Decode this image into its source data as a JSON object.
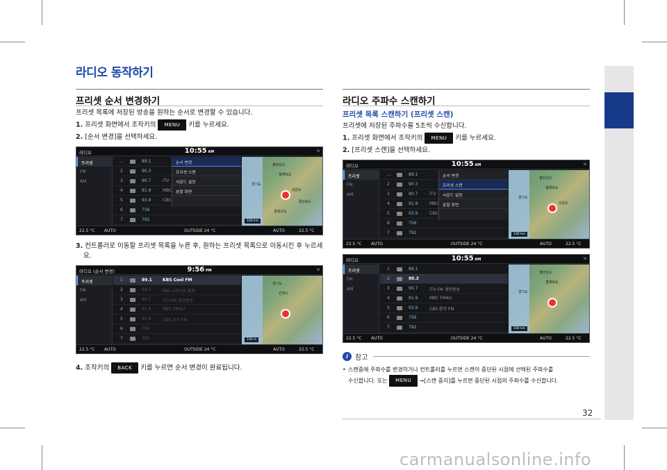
{
  "main_title": "라디오 동작하기",
  "left": {
    "title": "프리셋 순서 변경하기",
    "intro": "프리셋 목록에 저장된 방송을 원하는 순서로 변경할 수 있습니다.",
    "step1_num": "1.",
    "step1_pre": "프리셋 화면에서 조작키의",
    "step1_btn": "MENU",
    "step1_post": "키를 누르세요.",
    "step2_num": "2.",
    "step2_text": "[순서 변경]을 선택하세요.",
    "step3_num": "3.",
    "step3_text": "컨트롤러로 이동할 프리셋 목록을 누른 후, 원하는 프리셋 목록으로 이동시킨 후 누르세요.",
    "step4_num": "4.",
    "step4_pre": "조작키의",
    "step4_btn": "BACK",
    "step4_post": "키를 누르면 순서 변경이 완료됩니다."
  },
  "right": {
    "title": "라디오 주파수 스캔하기",
    "subtitle": "프리셋 목록 스캔하기 (프리셋 스캔)",
    "intro": "프리셋에 저장된 주파수를 5초씩 수신합니다.",
    "step1_num": "1.",
    "step1_pre": "프리셋 화면에서 조작키의",
    "step1_btn": "MENU",
    "step1_post": "키를 누르세요.",
    "step2_num": "2.",
    "step2_text": "[프리셋 스캔]을 선택하세요.",
    "note_label": "참고",
    "note_1": "스캔중에 주파수를 변경하거나 컨트롤러를 누르면 스캔이 중단된 시점에 선택된 주파수를",
    "note_2_pre": "수신합니다. 또는",
    "note_btn": "MENU",
    "note_2_post": "→[스캔 중지]를 누르면 중단된 시점의 주파수를 수신합니다."
  },
  "screens": {
    "s1": {
      "title": "라디오",
      "clock": "10:55",
      "ampm": "AM",
      "bands": [
        "프리셋",
        "FM",
        "AM"
      ],
      "rows": [
        {
          "n": "...",
          "f": "89.1",
          "s": ""
        },
        {
          "n": "2",
          "f": "90.3",
          "s": ""
        },
        {
          "n": "3",
          "f": "90.7",
          "s": "iTV"
        },
        {
          "n": "4",
          "f": "91.9",
          "s": "MBC"
        },
        {
          "n": "5",
          "f": "93.9",
          "s": "CBS"
        },
        {
          "n": "6",
          "f": "756",
          "s": ""
        },
        {
          "n": "7",
          "f": "792",
          "s": ""
        }
      ],
      "menu": [
        "순서 변경",
        "프리셋 스캔",
        "사운드 설정",
        "분할 화면"
      ],
      "bottom": [
        "22.5 °C",
        "AUTO",
        "OUTSIDE  24 °C",
        "AUTO",
        "22.5 °C"
      ],
      "map": [
        "평안남도",
        "황해북도",
        "경기도",
        "강원도",
        "경상북도",
        "충청남도"
      ],
      "dist": "100 km"
    },
    "s2": {
      "title": "라디오 (순서 변경)",
      "clock": "9:56",
      "ampm": "PM",
      "bands": [
        "프리셋",
        "FM",
        "AM"
      ],
      "rows": [
        {
          "n": "1",
          "f": "89.1",
          "s": "KBS Cool FM"
        },
        {
          "n": "2",
          "f": "90.3",
          "s": "KBS 1라디오 표준"
        },
        {
          "n": "3",
          "f": "90.7",
          "s": "iTV FM 경인방송"
        },
        {
          "n": "4",
          "f": "91.9",
          "s": "MBC FM4U"
        },
        {
          "n": "5",
          "f": "93.9",
          "s": "CBS 음악 FM"
        },
        {
          "n": "6",
          "f": "756",
          "s": ""
        },
        {
          "n": "7",
          "f": "792",
          "s": ""
        }
      ],
      "bottom": [
        "22.5 °C",
        "AUTO",
        "OUTSIDE  24 °C",
        "AUTO",
        "22.5 °C"
      ],
      "map": [
        "경기도",
        "킨텍스"
      ],
      "dist": "100 m"
    },
    "s3": {
      "title": "라디오",
      "clock": "10:55",
      "ampm": "AM",
      "bands": [
        "프리셋",
        "FM",
        "AM"
      ],
      "rows": [
        {
          "n": "...",
          "f": "89.1",
          "s": ""
        },
        {
          "n": "2",
          "f": "90.3",
          "s": ""
        },
        {
          "n": "3",
          "f": "90.7",
          "s": "iTV"
        },
        {
          "n": "4",
          "f": "91.9",
          "s": "MBC"
        },
        {
          "n": "5",
          "f": "93.9",
          "s": "CBS"
        },
        {
          "n": "6",
          "f": "756",
          "s": ""
        },
        {
          "n": "7",
          "f": "792",
          "s": ""
        }
      ],
      "menu": [
        "순서 변경",
        "프리셋 스캔",
        "사운드 설정",
        "분할 화면"
      ],
      "bottom": [
        "22.5 °C",
        "AUTO",
        "OUTSIDE  24 °C",
        "AUTO",
        "22.5 °C"
      ],
      "map": [
        "평안남도",
        "황해북도",
        "경기도",
        "강원도"
      ],
      "dist": "100 km"
    },
    "s4": {
      "title": "라디오",
      "clock": "10:55",
      "ampm": "AM",
      "bands": [
        "프리셋",
        "FM",
        "AM"
      ],
      "rows": [
        {
          "n": "1",
          "f": "89.1",
          "s": ""
        },
        {
          "n": "2",
          "f": "90.3",
          "s": ""
        },
        {
          "n": "3",
          "f": "90.7",
          "s": "iTV FM 경인방송"
        },
        {
          "n": "4",
          "f": "91.9",
          "s": "MBC FM4U"
        },
        {
          "n": "5",
          "f": "93.9",
          "s": "CBS 음악 FM"
        },
        {
          "n": "6",
          "f": "756",
          "s": ""
        },
        {
          "n": "7",
          "f": "792",
          "s": ""
        }
      ],
      "bottom": [
        "22.5 °C",
        "AUTO",
        "OUTSIDE  24 °C",
        "AUTO",
        "22.5 °C"
      ],
      "map": [
        "평안남도",
        "황해북도",
        "경기도"
      ],
      "dist": "100 km"
    }
  },
  "page_number": "32",
  "watermark": "carmanualsonline.info"
}
